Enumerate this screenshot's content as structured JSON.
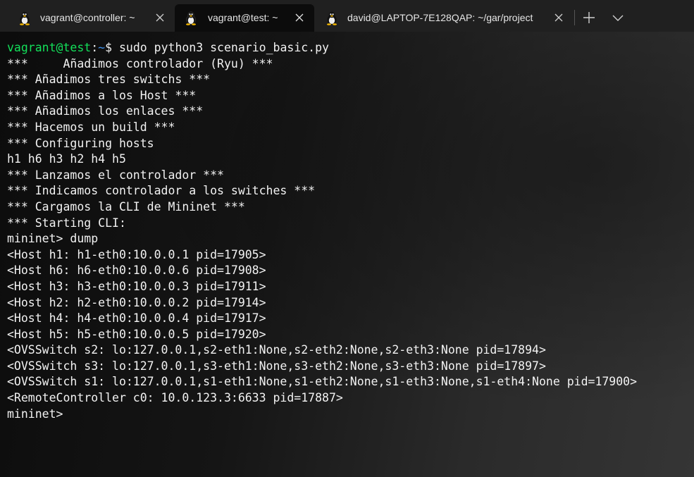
{
  "tabs": [
    {
      "title": "vagrant@controller: ~",
      "active": false
    },
    {
      "title": "vagrant@test: ~",
      "active": true
    },
    {
      "title": "david@LAPTOP-7E128QAP: ~/gar/project",
      "active": false
    }
  ],
  "tab_icon": "linux-tux-icon",
  "toolbar": {
    "new_tab_icon": "plus-icon",
    "dropdown_icon": "chevron-down-icon"
  },
  "colors": {
    "prompt_user": "#13e05a",
    "prompt_path": "#3b8eea",
    "text": "#f2f2f2",
    "background": "#0c0c0c"
  },
  "terminal": {
    "prompt": {
      "user_host": "vagrant@test",
      "colon": ":",
      "path": "~",
      "symbol": "$ ",
      "command": "sudo python3 scenario_basic.py"
    },
    "output": [
      "***     Añadimos controlador (Ryu) ***",
      "*** Añadimos tres switchs ***",
      "*** Añadimos a los Host ***",
      "*** Añadimos los enlaces ***",
      "*** Hacemos un build ***",
      "*** Configuring hosts",
      "h1 h6 h3 h2 h4 h5",
      "*** Lanzamos el controlador ***",
      "*** Indicamos controlador a los switches ***",
      "*** Cargamos la CLI de Mininet ***",
      "*** Starting CLI:",
      "mininet> dump",
      "<Host h1: h1-eth0:10.0.0.1 pid=17905>",
      "<Host h6: h6-eth0:10.0.0.6 pid=17908>",
      "<Host h3: h3-eth0:10.0.0.3 pid=17911>",
      "<Host h2: h2-eth0:10.0.0.2 pid=17914>",
      "<Host h4: h4-eth0:10.0.0.4 pid=17917>",
      "<Host h5: h5-eth0:10.0.0.5 pid=17920>",
      "<OVSSwitch s2: lo:127.0.0.1,s2-eth1:None,s2-eth2:None,s2-eth3:None pid=17894>",
      "<OVSSwitch s3: lo:127.0.0.1,s3-eth1:None,s3-eth2:None,s3-eth3:None pid=17897>",
      "<OVSSwitch s1: lo:127.0.0.1,s1-eth1:None,s1-eth2:None,s1-eth3:None,s1-eth4:None pid=17900>",
      "<RemoteController c0: 10.0.123.3:6633 pid=17887>"
    ],
    "current_prompt": "mininet>"
  }
}
